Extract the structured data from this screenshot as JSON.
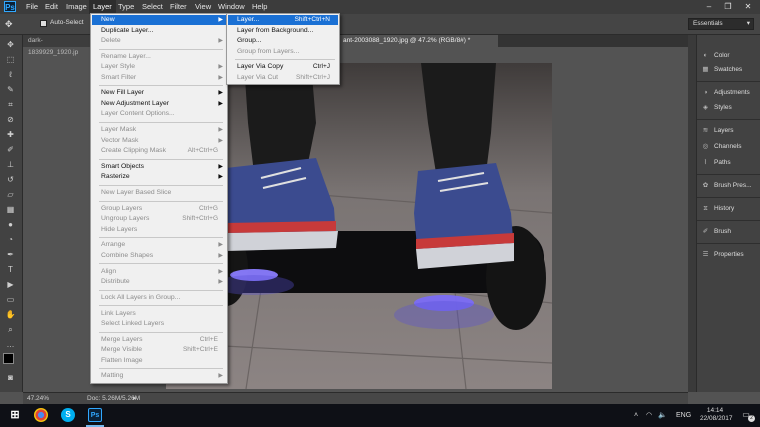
{
  "app": {
    "logo": "Ps"
  },
  "menubar": {
    "items": [
      "File",
      "Edit",
      "Image",
      "Layer",
      "Type",
      "Select",
      "Filter",
      "View",
      "Window",
      "Help"
    ],
    "window_controls": [
      "–",
      "❐",
      "✕"
    ]
  },
  "options_bar": {
    "auto_select_label": "Auto-Select",
    "workspace": "Essentials"
  },
  "tabs": [
    {
      "label": "dark-1839929_1920.jp"
    },
    {
      "label": "ant-2003088_1920.jpg @ 47.2% (RGB/8#) *"
    }
  ],
  "statusbar": {
    "zoom": "47.24%",
    "doc": "Doc: 5.26M/5.26M"
  },
  "right_panel": {
    "items": [
      {
        "label": "Color",
        "icon": "color-wheel-icon"
      },
      {
        "label": "Swatches",
        "icon": "grid-icon"
      },
      {
        "label": "Adjustments",
        "icon": "adjust-icon"
      },
      {
        "label": "Styles",
        "icon": "styles-icon"
      },
      {
        "label": "Layers",
        "icon": "layers-icon"
      },
      {
        "label": "Channels",
        "icon": "channels-icon"
      },
      {
        "label": "Paths",
        "icon": "paths-icon"
      },
      {
        "label": "Brush Pres...",
        "icon": "brush-presets-icon"
      },
      {
        "label": "History",
        "icon": "history-icon"
      },
      {
        "label": "Brush",
        "icon": "brush-icon"
      },
      {
        "label": "Properties",
        "icon": "properties-icon"
      }
    ]
  },
  "layer_menu": {
    "items": [
      {
        "label": "New",
        "sub": true,
        "highlight": true
      },
      {
        "label": "Duplicate Layer...",
        "shortcut": ""
      },
      {
        "label": "Delete",
        "sub": true,
        "disabled": true
      },
      {
        "sep": true
      },
      {
        "label": "Rename Layer...",
        "disabled": true
      },
      {
        "label": "Layer Style",
        "sub": true,
        "disabled": true
      },
      {
        "label": "Smart Filter",
        "sub": true,
        "disabled": true
      },
      {
        "sep": true
      },
      {
        "label": "New Fill Layer",
        "sub": true
      },
      {
        "label": "New Adjustment Layer",
        "sub": true
      },
      {
        "label": "Layer Content Options...",
        "disabled": true
      },
      {
        "sep": true
      },
      {
        "label": "Layer Mask",
        "sub": true,
        "disabled": true
      },
      {
        "label": "Vector Mask",
        "sub": true,
        "disabled": true
      },
      {
        "label": "Create Clipping Mask",
        "shortcut": "Alt+Ctrl+G",
        "disabled": true
      },
      {
        "sep": true
      },
      {
        "label": "Smart Objects",
        "sub": true
      },
      {
        "label": "Rasterize",
        "sub": true
      },
      {
        "sep": true
      },
      {
        "label": "New Layer Based Slice",
        "disabled": true
      },
      {
        "sep": true
      },
      {
        "label": "Group Layers",
        "shortcut": "Ctrl+G",
        "disabled": true
      },
      {
        "label": "Ungroup Layers",
        "shortcut": "Shift+Ctrl+G",
        "disabled": true
      },
      {
        "label": "Hide Layers",
        "disabled": true
      },
      {
        "sep": true
      },
      {
        "label": "Arrange",
        "sub": true,
        "disabled": true
      },
      {
        "label": "Combine Shapes",
        "sub": true,
        "disabled": true
      },
      {
        "sep": true
      },
      {
        "label": "Align",
        "sub": true,
        "disabled": true
      },
      {
        "label": "Distribute",
        "sub": true,
        "disabled": true
      },
      {
        "sep": true
      },
      {
        "label": "Lock All Layers in Group...",
        "disabled": true
      },
      {
        "sep": true
      },
      {
        "label": "Link Layers",
        "disabled": true
      },
      {
        "label": "Select Linked Layers",
        "disabled": true
      },
      {
        "sep": true
      },
      {
        "label": "Merge Layers",
        "shortcut": "Ctrl+E",
        "disabled": true
      },
      {
        "label": "Merge Visible",
        "shortcut": "Shift+Ctrl+E",
        "disabled": true
      },
      {
        "label": "Flatten Image",
        "disabled": true
      },
      {
        "sep": true
      },
      {
        "label": "Matting",
        "sub": true,
        "disabled": true
      }
    ]
  },
  "new_submenu": {
    "items": [
      {
        "label": "Layer...",
        "shortcut": "Shift+Ctrl+N",
        "highlight": true
      },
      {
        "label": "Layer from Background..."
      },
      {
        "label": "Group..."
      },
      {
        "label": "Group from Layers...",
        "disabled": true
      },
      {
        "sep": true
      },
      {
        "label": "Layer Via Copy",
        "shortcut": "Ctrl+J"
      },
      {
        "label": "Layer Via Cut",
        "shortcut": "Shift+Ctrl+J",
        "disabled": true
      }
    ]
  },
  "taskbar": {
    "apps": [
      {
        "name": "start",
        "icon": "windows-icon"
      },
      {
        "name": "chrome",
        "icon": "chrome-icon"
      },
      {
        "name": "skype",
        "icon": "skype-icon",
        "glyph": "S"
      },
      {
        "name": "photoshop",
        "icon": "photoshop-icon",
        "glyph": "Ps"
      }
    ],
    "language": "ENG",
    "time": "14:14",
    "date": "22/08/2017",
    "notification_count": "2"
  },
  "colors": {
    "menu_highlight": "#1a70d4",
    "app_bg": "#535353",
    "menubar": "#3c3c3c",
    "ps_blue": "#31a8ff"
  }
}
